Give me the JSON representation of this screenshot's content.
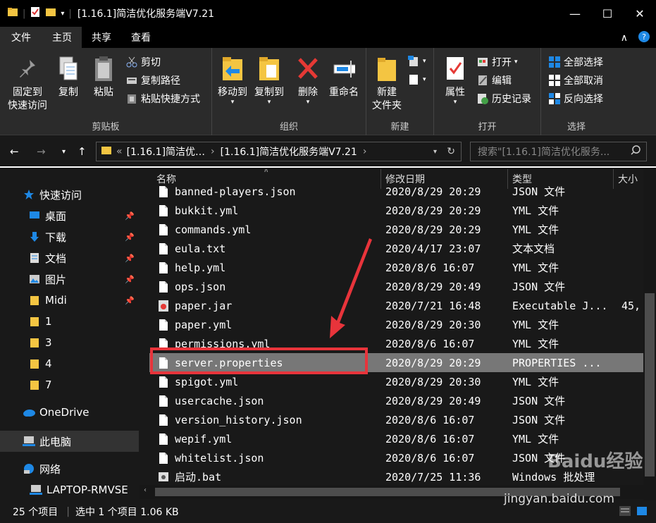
{
  "window": {
    "title": "[1.16.1]简洁优化服务端V7.21",
    "minimize": "—",
    "maximize": "☐",
    "close": "✕"
  },
  "tabs": [
    {
      "label": "文件"
    },
    {
      "label": "主页"
    },
    {
      "label": "共享"
    },
    {
      "label": "查看"
    }
  ],
  "ribbon": {
    "clipboard": {
      "pin": "固定到\n快速访问",
      "pin_l1": "固定到",
      "pin_l2": "快速访问",
      "copy": "复制",
      "paste": "粘贴",
      "cut": "剪切",
      "copy_path": "复制路径",
      "paste_shortcut": "粘贴快捷方式",
      "label": "剪贴板"
    },
    "organize": {
      "move_to": "移动到",
      "copy_to": "复制到",
      "delete": "删除",
      "rename": "重命名",
      "label": "组织"
    },
    "new": {
      "new_folder_l1": "新建",
      "new_folder_l2": "文件夹",
      "label": "新建"
    },
    "open": {
      "properties": "属性",
      "open": "打开",
      "edit": "编辑",
      "history": "历史记录",
      "label": "打开"
    },
    "select": {
      "select_all": "全部选择",
      "select_none": "全部取消",
      "invert": "反向选择",
      "label": "选择"
    }
  },
  "address": {
    "prefix": "«",
    "crumb1": "[1.16.1]简洁优…",
    "sep": "›",
    "crumb2": "[1.16.1]简洁优化服务端V7.21",
    "search_placeholder": "搜索\"[1.16.1]简洁优化服务..."
  },
  "sidebar": {
    "quick_access": "快速访问",
    "items": [
      {
        "label": "桌面"
      },
      {
        "label": "下载"
      },
      {
        "label": "文档"
      },
      {
        "label": "图片"
      },
      {
        "label": "Midi"
      },
      {
        "label": "1"
      },
      {
        "label": "3"
      },
      {
        "label": "4"
      },
      {
        "label": "7"
      }
    ],
    "onedrive": "OneDrive",
    "this_pc": "此电脑",
    "network": "网络",
    "laptop": "LAPTOP-RMVSE"
  },
  "columns": {
    "name": "名称",
    "date": "修改日期",
    "type": "类型",
    "size": "大小"
  },
  "files": [
    {
      "name": "banned-players.json",
      "date": "2020/8/29 20:29",
      "type": "JSON 文件",
      "size": ""
    },
    {
      "name": "bukkit.yml",
      "date": "2020/8/29 20:29",
      "type": "YML 文件",
      "size": ""
    },
    {
      "name": "commands.yml",
      "date": "2020/8/29 20:29",
      "type": "YML 文件",
      "size": ""
    },
    {
      "name": "eula.txt",
      "date": "2020/4/17 23:07",
      "type": "文本文档",
      "size": ""
    },
    {
      "name": "help.yml",
      "date": "2020/8/6 16:07",
      "type": "YML 文件",
      "size": ""
    },
    {
      "name": "ops.json",
      "date": "2020/8/29 20:49",
      "type": "JSON 文件",
      "size": ""
    },
    {
      "name": "paper.jar",
      "date": "2020/7/21 16:48",
      "type": "Executable J...",
      "size": "45,"
    },
    {
      "name": "paper.yml",
      "date": "2020/8/29 20:30",
      "type": "YML 文件",
      "size": ""
    },
    {
      "name": "permissions.yml",
      "date": "2020/8/6 16:07",
      "type": "YML 文件",
      "size": ""
    },
    {
      "name": "server.properties",
      "date": "2020/8/29 20:29",
      "type": "PROPERTIES ...",
      "size": ""
    },
    {
      "name": "spigot.yml",
      "date": "2020/8/29 20:30",
      "type": "YML 文件",
      "size": ""
    },
    {
      "name": "usercache.json",
      "date": "2020/8/29 20:49",
      "type": "JSON 文件",
      "size": ""
    },
    {
      "name": "version_history.json",
      "date": "2020/8/6 16:07",
      "type": "JSON 文件",
      "size": ""
    },
    {
      "name": "wepif.yml",
      "date": "2020/8/6 16:07",
      "type": "YML 文件",
      "size": ""
    },
    {
      "name": "whitelist.json",
      "date": "2020/8/6 16:07",
      "type": "JSON 文件",
      "size": ""
    },
    {
      "name": "启动.bat",
      "date": "2020/7/25 11:36",
      "type": "Windows 批处理",
      "size": ""
    }
  ],
  "status": {
    "count": "25 个项目",
    "selected": "选中 1 个项目  1.06 KB"
  },
  "watermark": {
    "logo": "Baidu经验",
    "url": "jingyan.baidu.com"
  },
  "colors": {
    "highlight": "#e8343b",
    "selected_row": "#777777",
    "ribbon_bg": "#2b2b2b"
  }
}
